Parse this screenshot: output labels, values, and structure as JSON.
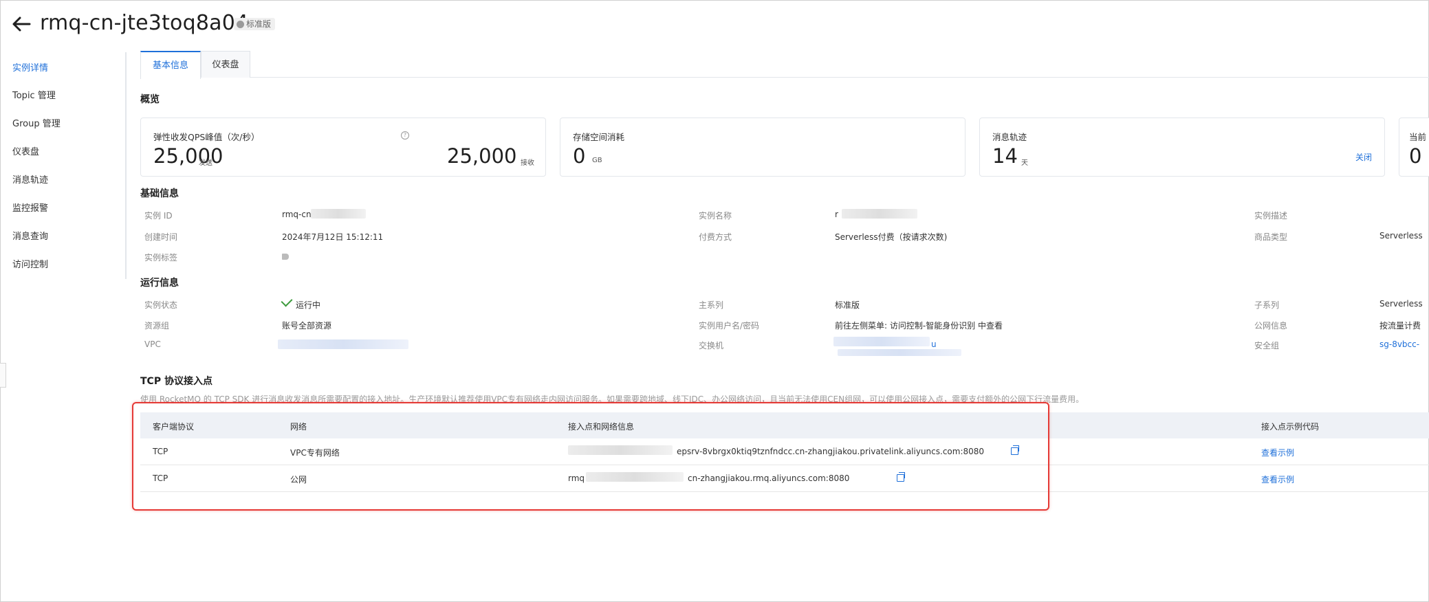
{
  "header": {
    "title": "rmq-cn-jte3toq8a04",
    "edition_badge": "标准版"
  },
  "sidebar": {
    "items": [
      {
        "label": "实例详情",
        "active": true
      },
      {
        "label": "Topic 管理"
      },
      {
        "label": "Group 管理"
      },
      {
        "label": "仪表盘"
      },
      {
        "label": "消息轨迹"
      },
      {
        "label": "监控报警"
      },
      {
        "label": "消息查询"
      },
      {
        "label": "访问控制"
      }
    ]
  },
  "tabs": [
    {
      "label": "基本信息",
      "active": true
    },
    {
      "label": "仪表盘"
    }
  ],
  "overview": {
    "title": "概览",
    "qps": {
      "label": "弹性收发QPS峰值（次/秒）",
      "send_value": "25,000",
      "send_unit": "发送",
      "recv_value": "25,000",
      "recv_unit": "接收"
    },
    "storage": {
      "label": "存储空间消耗",
      "value": "0",
      "unit": "GB"
    },
    "trace": {
      "label": "消息轨迹",
      "value": "14",
      "unit": "天",
      "action": "关闭"
    },
    "current": {
      "label": "当前",
      "value": "0"
    }
  },
  "basic_info": {
    "title": "基础信息",
    "instance_id_label": "实例 ID",
    "instance_id_value": "rmq-cn",
    "instance_name_label": "实例名称",
    "instance_name_value": "r",
    "instance_desc_label": "实例描述",
    "created_label": "创建时间",
    "created_value": "2024年7月12日 15:12:11",
    "billing_label": "付费方式",
    "billing_value": "Serverless付费（按请求次数)",
    "product_label": "商品类型",
    "product_value": "Serverless",
    "tags_label": "实例标签"
  },
  "runtime_info": {
    "title": "运行信息",
    "status_label": "实例状态",
    "status_value": "运行中",
    "series_label": "主系列",
    "series_value": "标准版",
    "subseries_label": "子系列",
    "subseries_value": "Serverless",
    "resgroup_label": "资源组",
    "resgroup_value": "账号全部资源",
    "credentials_label": "实例用户名/密码",
    "credentials_value": "前往左侧菜单: 访问控制-智能身份识别 中查看",
    "public_label": "公网信息",
    "public_value": "按流量计费",
    "vpc_label": "VPC",
    "vswitch_label": "交换机",
    "vswitch_value": "u",
    "secgroup_label": "安全组",
    "secgroup_value": "sg-8vbcc-"
  },
  "tcp": {
    "title": "TCP 协议接入点",
    "description": "使用 RocketMQ 的 TCP SDK 进行消息收发消息所需要配置的接入地址。生产环境默认推荐使用VPC专有网络走内网访问服务。如果需要跨地域、线下IDC、办公网络访问，且当前无法使用CEN组网，可以使用公网接入点，需要支付额外的公网下行流量费用。",
    "headers": {
      "protocol": "客户端协议",
      "network": "网络",
      "endpoint": "接入点和网络信息",
      "sample": "接入点示例代码"
    },
    "rows": [
      {
        "protocol": "TCP",
        "network": "VPC专有网络",
        "endpoint": "epsrv-8vbrgx0ktiq9tznfndcc.cn-zhangjiakou.privatelink.aliyuncs.com:8080",
        "sample": "查看示例"
      },
      {
        "protocol": "TCP",
        "network": "公网",
        "endpoint_prefix": "rmq",
        "endpoint": "cn-zhangjiakou.rmq.aliyuncs.com:8080",
        "sample": "查看示例"
      }
    ]
  },
  "colors": {
    "accent": "#1e6fd9",
    "highlight": "#e53935",
    "success": "#3c9a3c"
  }
}
